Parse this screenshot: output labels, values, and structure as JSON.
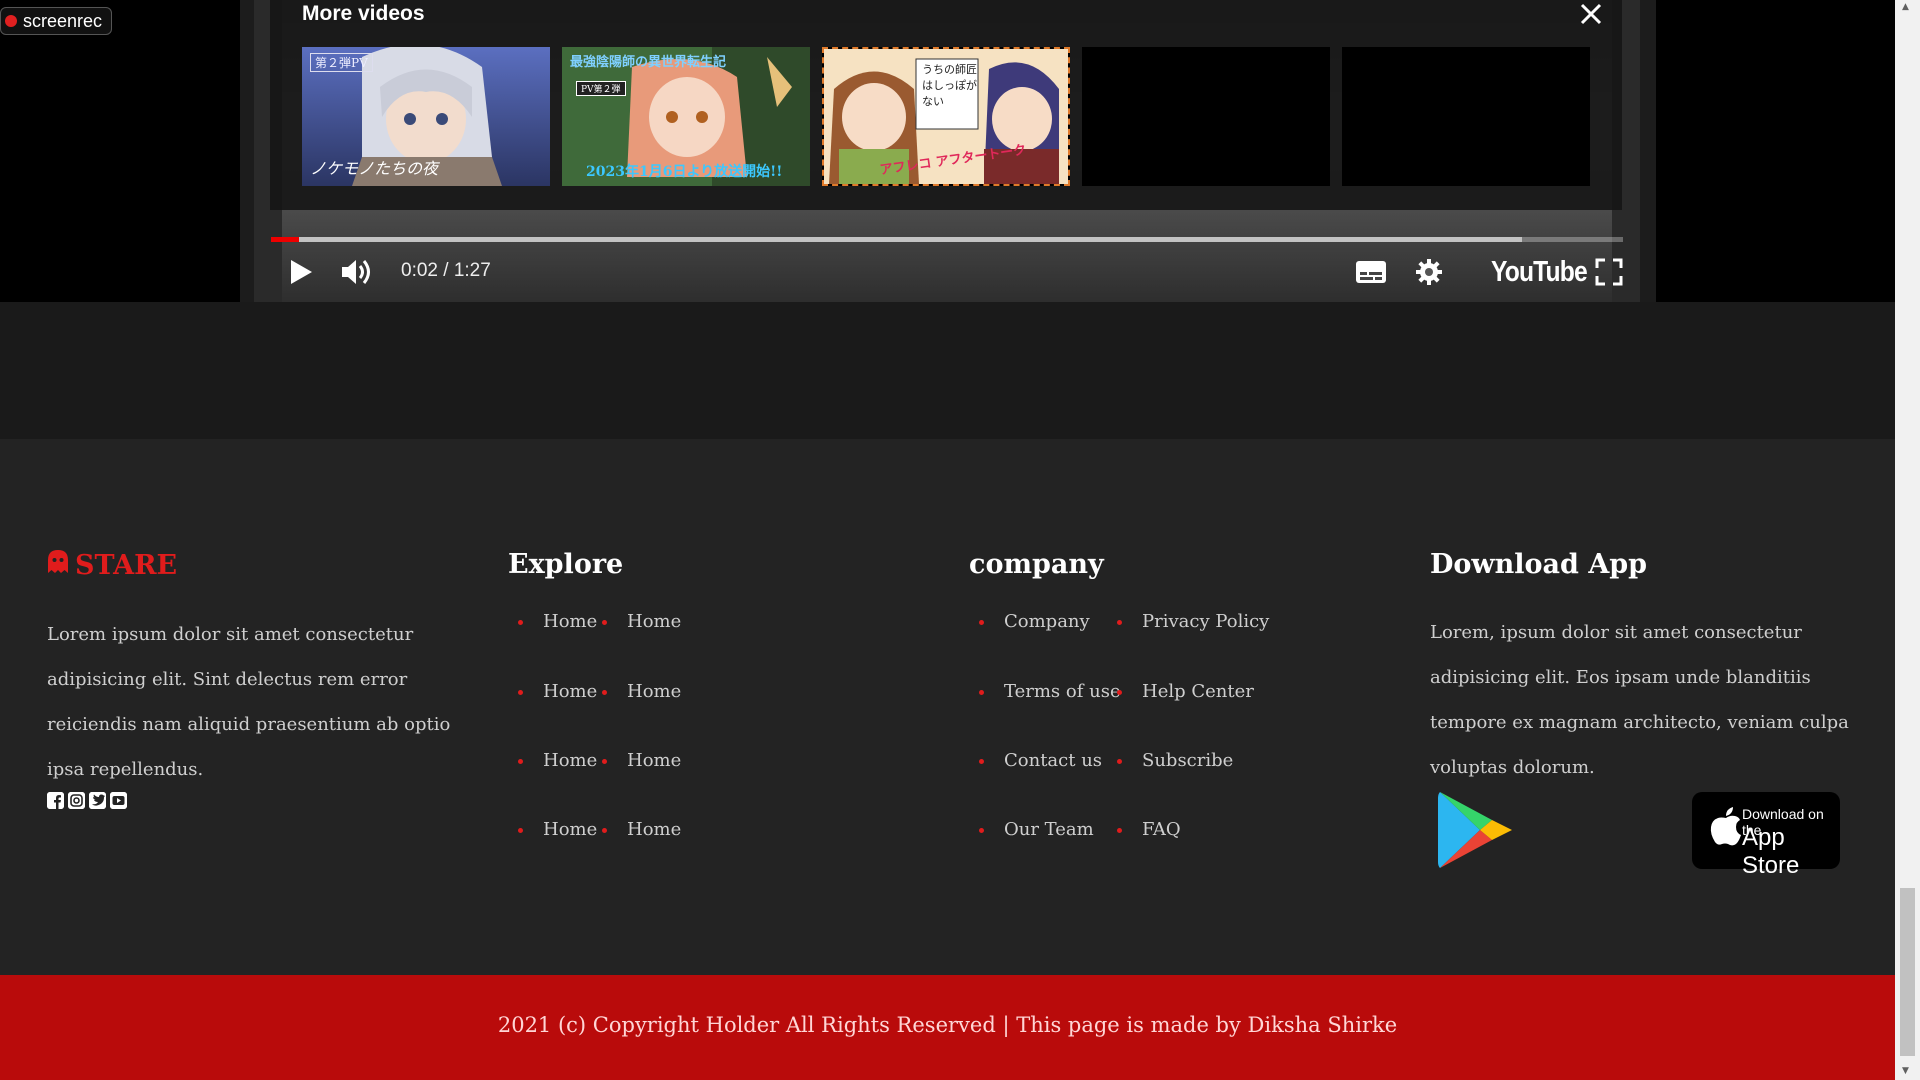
{
  "overlay": {
    "screenrec_label": "screenrec"
  },
  "player": {
    "more_videos_title": "More videos",
    "close_icon": "close-icon",
    "thumbnails": [
      {
        "tag": "第２弾PV",
        "caption": "ノケモノたちの夜"
      },
      {
        "tag": "PV第２弾",
        "caption": "2023年1月6日より放送開始!!",
        "heading": "最強陰陽師の異世界転生記"
      },
      {
        "tag": "",
        "caption": "アフレコ アフタートーク",
        "heading": "うちの師匠はしっぽがない"
      },
      {
        "tag": "",
        "caption": ""
      },
      {
        "tag": "",
        "caption": ""
      }
    ],
    "time_display": "0:02 / 1:27",
    "progress_fraction": 0.021,
    "buffer_fraction": 0.925,
    "logo_text": "YouTube",
    "icons": [
      "play-icon",
      "volume-icon",
      "subtitles-icon",
      "settings-icon",
      "fullscreen-icon"
    ]
  },
  "footer": {
    "brand": {
      "name": "STARE",
      "icon": "ghost-icon",
      "color": "#e01c1c",
      "description": "Lorem ipsum dolor sit amet consectetur adipisicing elit. Sint delectus rem error reiciendis nam aliquid praesentium ab optio ipsa repellendus."
    },
    "socials": [
      "facebook-icon",
      "instagram-icon",
      "twitter-icon",
      "youtube-icon"
    ],
    "explore": {
      "heading": "Explore",
      "links": [
        "Home",
        "Home",
        "Home",
        "Home",
        "Home",
        "Home",
        "Home",
        "Home"
      ]
    },
    "company": {
      "heading": "company",
      "links": [
        "Company",
        "Privacy Policy",
        "Terms of use",
        "Help Center",
        "Contact us",
        "Subscribe",
        "Our Team",
        "FAQ"
      ]
    },
    "download": {
      "heading": "Download App",
      "description": "Lorem, ipsum dolor sit amet consectetur adipisicing elit. Eos ipsam unde blanditiis tempore ex magnam architecto, veniam culpa voluptas dolorum.",
      "app_store_small": "Download on the",
      "app_store_big": "App Store"
    },
    "copyright": "2021 (c) Copyright Holder All Rights Reserved | This page is made by Diksha Shirke"
  }
}
